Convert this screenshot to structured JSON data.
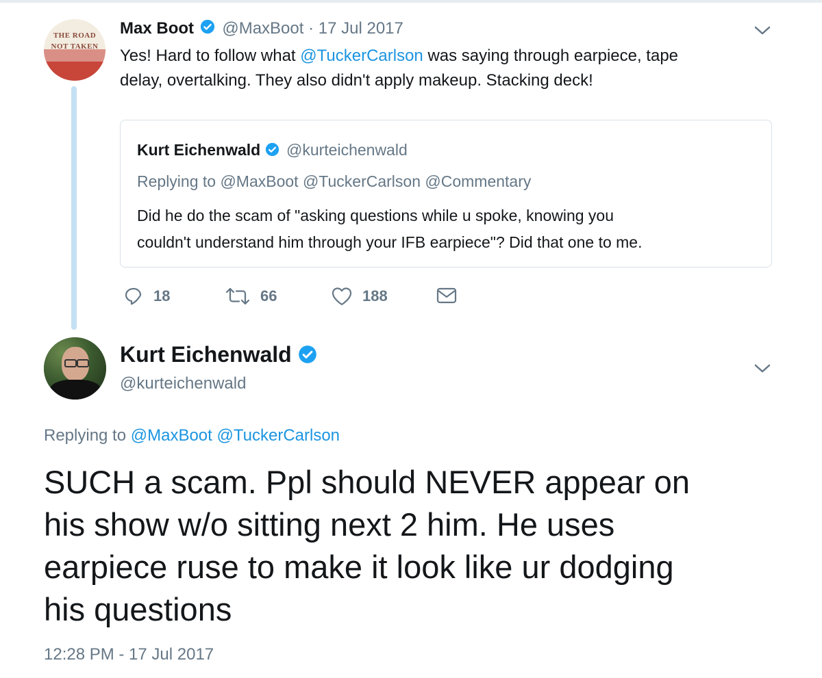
{
  "tweet1": {
    "avatar_text_line1": "THE ROAD",
    "avatar_text_line2": "NOT TAKEN",
    "name": "Max Boot",
    "handle": "@MaxBoot",
    "separator": "·",
    "date": "17 Jul 2017",
    "text_before": "Yes! Hard to follow what ",
    "mention": "@TuckerCarlson",
    "text_after_line1": " was saying through earpiece, tape",
    "text_line2": "delay, overtalking. They also didn't apply makeup. Stacking deck!",
    "quote": {
      "name": "Kurt Eichenwald",
      "handle": "@kurteichenwald",
      "replying_to": "Replying to @MaxBoot @TuckerCarlson @Commentary",
      "text_line1": "Did he do the scam of \"asking questions while u spoke, knowing you",
      "text_line2": "couldn't understand him through your IFB earpiece\"? Did that one to me."
    },
    "reply_count": "18",
    "retweet_count": "66",
    "like_count": "188"
  },
  "tweet2": {
    "name": "Kurt Eichenwald",
    "handle": "@kurteichenwald",
    "replying_prefix": "Replying to ",
    "replying_handles": "@MaxBoot @TuckerCarlson",
    "text_line1": "SUCH a scam. Ppl should NEVER appear on",
    "text_line2": "his show w/o sitting next 2 him. He uses",
    "text_line3": "earpiece ruse to make it look like ur dodging",
    "text_line4": "his questions",
    "timestamp": "12:28 PM - 17 Jul 2017"
  },
  "icons": {
    "verified": "verified-badge-icon",
    "reply": "reply-icon",
    "retweet": "retweet-icon",
    "like": "heart-icon",
    "dm": "envelope-icon",
    "menu": "chevron-down-icon"
  },
  "colors": {
    "link": "#1b95e0",
    "secondary_text": "#657786",
    "thread_line": "#c4e0f3",
    "verified": "#1da1f2",
    "avatar1_red": "#c8453a"
  }
}
